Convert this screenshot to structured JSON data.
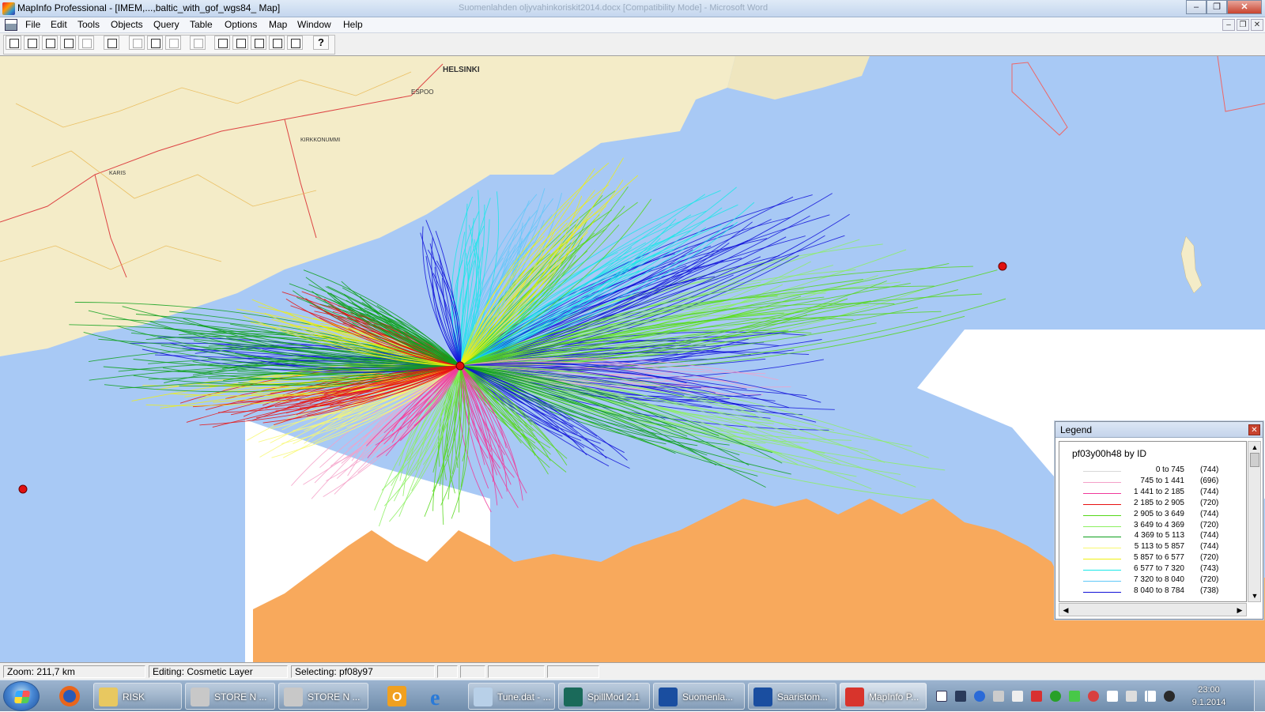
{
  "window": {
    "title": "MapInfo Professional - [IMEM,...,baltic_with_gof_wgs84_ Map]",
    "background_window_title": "Suomenlahden oljyvahinkoriskit2014.docx [Compatibility Mode] - Microsoft Word",
    "controls": {
      "minimize": "–",
      "restore": "❐",
      "close": "✕"
    }
  },
  "menu": {
    "items": [
      "File",
      "Edit",
      "Tools",
      "Objects",
      "Query",
      "Table",
      "Options",
      "Map",
      "Window",
      "Help"
    ],
    "mdi_controls": {
      "minimize": "–",
      "restore": "❐",
      "close": "✕"
    }
  },
  "toolbar": {
    "help_label": "?",
    "buttons": [
      "new-icon",
      "open-icon",
      "open-workspace-icon",
      "open-dbms-icon",
      "save-icon",
      "print-icon",
      "cut-icon",
      "copy-icon",
      "paste-icon",
      "undo-icon",
      "new-browser-icon",
      "new-mapper-icon",
      "new-grapher-icon",
      "new-layout-icon",
      "new-redistrict-icon",
      "help-pointer-icon"
    ]
  },
  "map": {
    "background_color": "#a8c9f5",
    "land_north_color": "#f4ecc8",
    "land_south_color": "#f8a95c",
    "spill_source_color": "#e01010",
    "city_label": "HELSINKI",
    "towns": [
      "ESPOO",
      "KIRKKONUMMI",
      "KARIS"
    ]
  },
  "legend": {
    "window_title": "Legend",
    "close_glyph": "✕",
    "heading": "pf03y00h48 by ID",
    "rows": [
      {
        "range": "0 to    745",
        "count": "(744)",
        "color": "#d8d8d8"
      },
      {
        "range": "745 to 1 441",
        "count": "(696)",
        "color": "#f4a0c8"
      },
      {
        "range": "1 441 to 2 185",
        "count": "(744)",
        "color": "#f0389a"
      },
      {
        "range": "2 185 to 2 905",
        "count": "(720)",
        "color": "#e81010"
      },
      {
        "range": "2 905 to 3 649",
        "count": "(744)",
        "color": "#55d818"
      },
      {
        "range": "3 649 to 4 369",
        "count": "(720)",
        "color": "#8cf060"
      },
      {
        "range": "4 369 to 5 113",
        "count": "(744)",
        "color": "#0ea01c"
      },
      {
        "range": "5 113 to 5 857",
        "count": "(744)",
        "color": "#f8f870"
      },
      {
        "range": "5 857 to 6 577",
        "count": "(720)",
        "color": "#f0f010"
      },
      {
        "range": "6 577 to 7 320",
        "count": "(743)",
        "color": "#18e8e8"
      },
      {
        "range": "7 320 to 8 040",
        "count": "(720)",
        "color": "#60c8f8"
      },
      {
        "range": "8 040 to 8 784",
        "count": "(738)",
        "color": "#1010d8"
      }
    ]
  },
  "status": {
    "zoom": "Zoom: 211,7 km",
    "editing": "Editing: Cosmetic Layer",
    "selecting": "Selecting: pf08y97"
  },
  "taskbar": {
    "tasks": [
      {
        "label": "RISK",
        "icon": "folder-icon",
        "color": "#e8c860"
      },
      {
        "label": "STORE N ...",
        "icon": "drive-icon",
        "color": "#c8c8c8"
      },
      {
        "label": "STORE N ...",
        "icon": "drive-icon",
        "color": "#c8c8c8"
      },
      {
        "label": "Tune.dat - ...",
        "icon": "notepad-icon",
        "color": "#b8d0e8"
      },
      {
        "label": "SpillMod 2.1",
        "icon": "spillmod-icon",
        "color": "#1a6a5a"
      },
      {
        "label": "Suomenla...",
        "icon": "word-icon",
        "color": "#1a4ea0"
      },
      {
        "label": "Saaristom...",
        "icon": "word-icon",
        "color": "#1a4ea0"
      },
      {
        "label": "MapInfo P...",
        "icon": "mapinfo-icon",
        "color": "#d8342c"
      }
    ],
    "clock_time": "23:00",
    "clock_date": "9.1.2014"
  }
}
